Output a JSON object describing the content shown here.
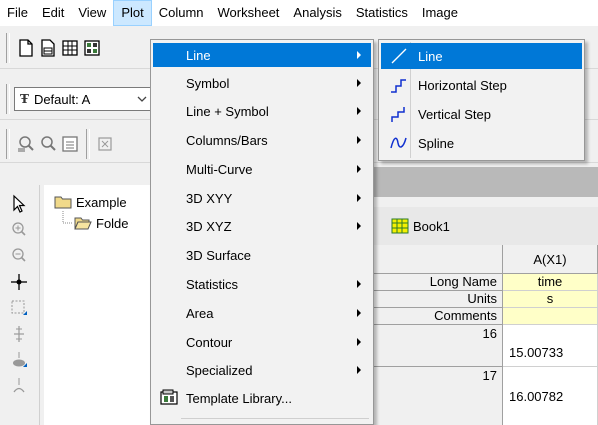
{
  "menubar": {
    "items": [
      "File",
      "Edit",
      "View",
      "Plot",
      "Column",
      "Worksheet",
      "Analysis",
      "Statistics",
      "Image"
    ],
    "active": "Plot"
  },
  "toolbar": {
    "font_combo_value": "Default: A",
    "font_combo_glyph": "Ŧ"
  },
  "plot_menu": {
    "items": [
      {
        "label": "Line",
        "submenu": true,
        "selected": true
      },
      {
        "label": "Symbol",
        "submenu": true
      },
      {
        "label": "Line + Symbol",
        "submenu": true
      },
      {
        "label": "Columns/Bars",
        "submenu": true
      },
      {
        "label": "Multi-Curve",
        "submenu": true
      },
      {
        "label": "3D XYY",
        "submenu": true
      },
      {
        "label": "3D XYZ",
        "submenu": true
      },
      {
        "label": "3D Surface",
        "submenu": false
      },
      {
        "label": "Statistics",
        "submenu": true
      },
      {
        "label": "Area",
        "submenu": true
      },
      {
        "label": "Contour",
        "submenu": true
      },
      {
        "label": "Specialized",
        "submenu": true
      },
      {
        "label": "Template Library...",
        "submenu": false,
        "icon": "template-library-icon"
      }
    ]
  },
  "line_submenu": {
    "items": [
      {
        "label": "Line",
        "icon": "line-plot-icon",
        "selected": true
      },
      {
        "label": "Horizontal Step",
        "icon": "horizontal-step-icon"
      },
      {
        "label": "Vertical Step",
        "icon": "vertical-step-icon"
      },
      {
        "label": "Spline",
        "icon": "spline-icon"
      }
    ]
  },
  "explorer": {
    "items": [
      {
        "label": "Example",
        "icon": "folder-icon"
      },
      {
        "label": "Folde",
        "icon": "open-folder-icon"
      }
    ]
  },
  "book": {
    "title": "Book1",
    "column_header": "A(X1)",
    "row_labels": [
      "Long Name",
      "Units",
      "Comments"
    ],
    "long_name": "time",
    "units": "s",
    "comments": "",
    "rows": [
      {
        "index": "16",
        "value": "15.00733"
      },
      {
        "index": "17",
        "value": "16.00782"
      }
    ]
  }
}
